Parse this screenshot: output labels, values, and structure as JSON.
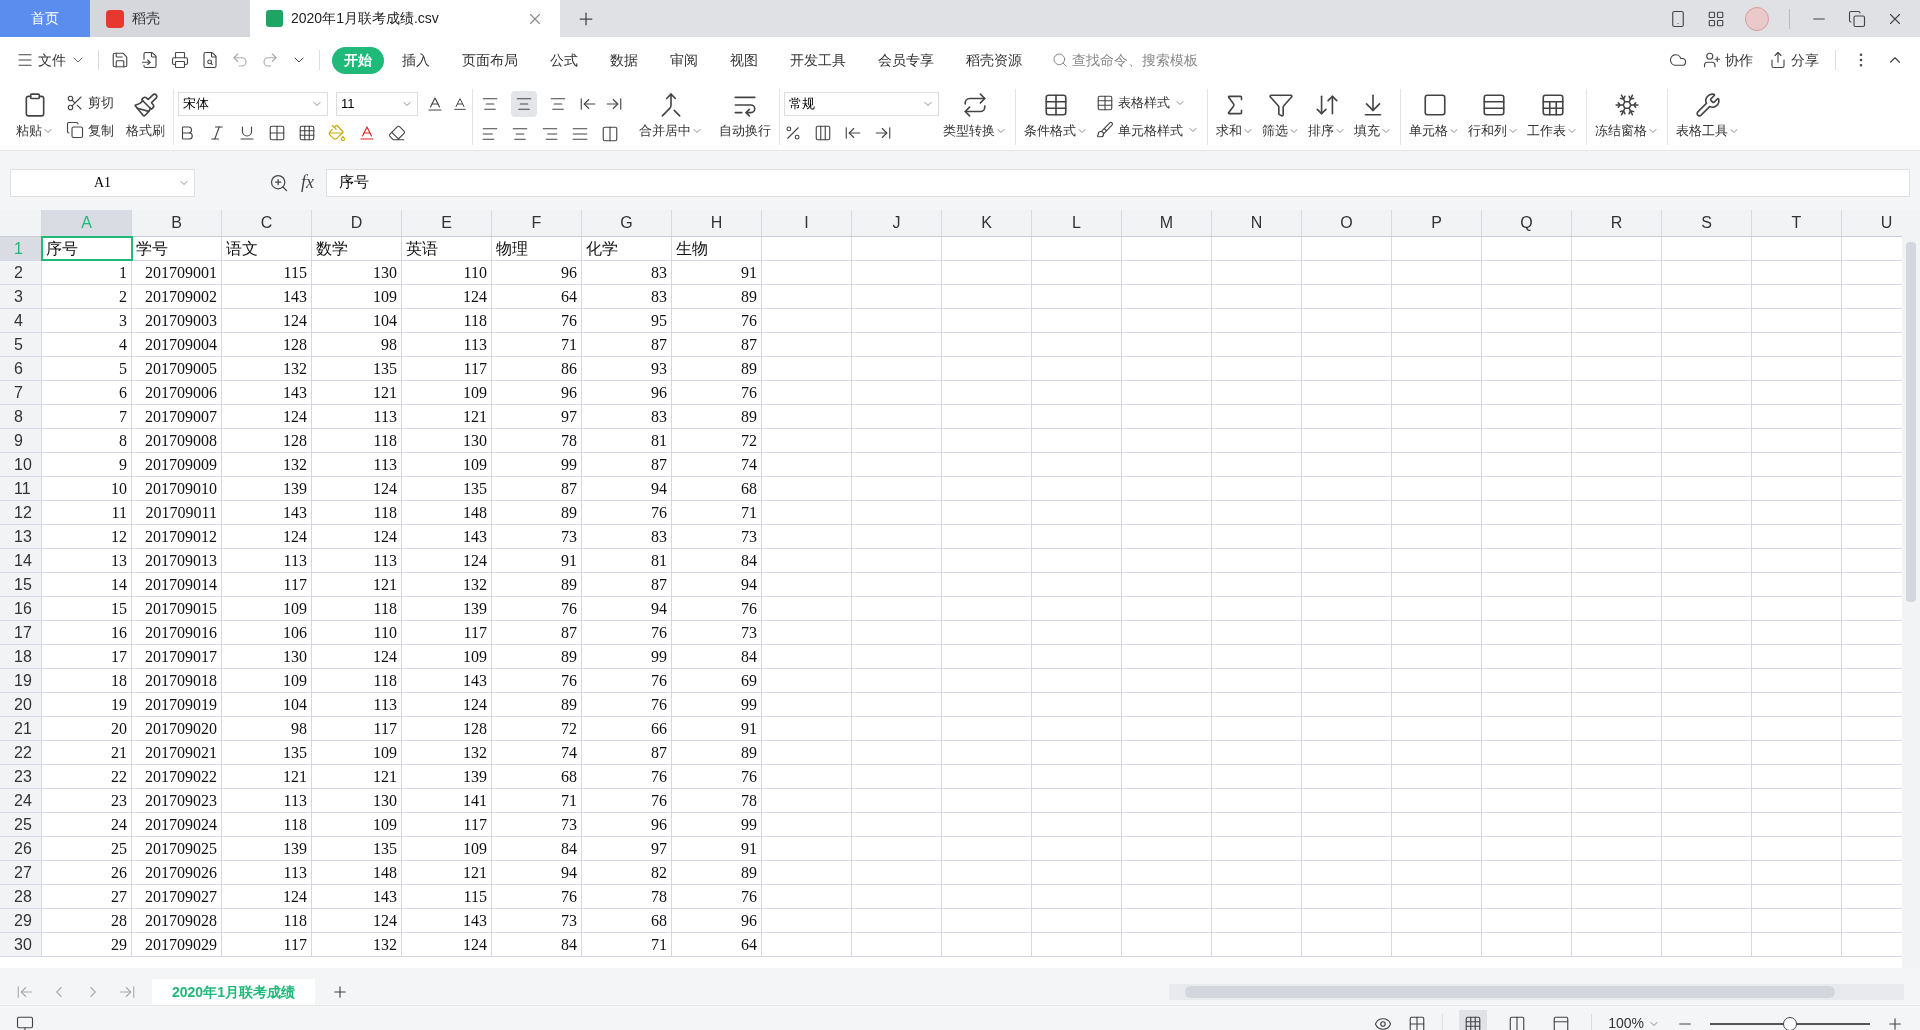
{
  "title_bar": {
    "tabs": [
      {
        "label": "首页",
        "kind": "home",
        "selected": false
      },
      {
        "label": "稻壳",
        "kind": "app",
        "selected": false
      },
      {
        "label": "2020年1月联考成绩.csv",
        "kind": "document",
        "selected": true
      }
    ]
  },
  "menu_bar": {
    "file": "文件",
    "tabs": [
      {
        "label": "开始",
        "selected": true
      },
      {
        "label": "插入",
        "selected": false
      },
      {
        "label": "页面布局",
        "selected": false
      },
      {
        "label": "公式",
        "selected": false
      },
      {
        "label": "数据",
        "selected": false
      },
      {
        "label": "审阅",
        "selected": false
      },
      {
        "label": "视图",
        "selected": false
      },
      {
        "label": "开发工具",
        "selected": false
      },
      {
        "label": "会员专享",
        "selected": false
      },
      {
        "label": "稻壳资源",
        "selected": false
      }
    ],
    "search": {
      "placeholder": "查找命令、搜索模板"
    },
    "collaborate": "协作",
    "share": "分享"
  },
  "ribbon": {
    "paste": "粘贴",
    "cut": "剪切",
    "copy": "复制",
    "format_painter": "格式刷",
    "font": "宋体",
    "font_size": "11",
    "vertical_align": [
      {
        "selected": false
      },
      {
        "selected": true
      },
      {
        "selected": false
      }
    ],
    "merge": "合并居中",
    "wrap": "自动换行",
    "number_format": "常规",
    "convert": "类型转换",
    "conditional_format": "条件格式",
    "table_style": "表格样式",
    "cell_style": "单元格样式",
    "tools": [
      {
        "label": "求和",
        "kind": "sum"
      },
      {
        "label": "筛选",
        "kind": "filter"
      },
      {
        "label": "排序",
        "kind": "sort"
      },
      {
        "label": "填充",
        "kind": "fill"
      },
      {
        "label": "单元格",
        "kind": "cell"
      },
      {
        "label": "行和列",
        "kind": "rowcol"
      },
      {
        "label": "工作表",
        "kind": "sheet"
      },
      {
        "label": "冻结窗格",
        "kind": "freeze"
      },
      {
        "label": "表格工具",
        "kind": "tools"
      }
    ]
  },
  "formula_bar": {
    "name_box": "A1",
    "fx": "fx",
    "formula": "序号"
  },
  "columns": [
    {
      "label": "A",
      "selected": true
    },
    {
      "label": "B",
      "selected": false
    },
    {
      "label": "C",
      "selected": false
    },
    {
      "label": "D",
      "selected": false
    },
    {
      "label": "E",
      "selected": false
    },
    {
      "label": "F",
      "selected": false
    },
    {
      "label": "G",
      "selected": false
    },
    {
      "label": "H",
      "selected": false
    },
    {
      "label": "I",
      "selected": false
    },
    {
      "label": "J",
      "selected": false
    },
    {
      "label": "K",
      "selected": false
    },
    {
      "label": "L",
      "selected": false
    },
    {
      "label": "M",
      "selected": false
    },
    {
      "label": "N",
      "selected": false
    },
    {
      "label": "O",
      "selected": false
    },
    {
      "label": "P",
      "selected": false
    },
    {
      "label": "Q",
      "selected": false
    },
    {
      "label": "R",
      "selected": false
    },
    {
      "label": "S",
      "selected": false
    },
    {
      "label": "T",
      "selected": false
    },
    {
      "label": "U",
      "selected": false
    }
  ],
  "rows": [
    {
      "number": "1",
      "kind": "header",
      "selected": true,
      "cells": [
        "序号",
        "学号",
        "语文",
        "数学",
        "英语",
        "物理",
        "化学",
        "生物"
      ]
    },
    {
      "number": "2",
      "kind": "data",
      "selected": false,
      "cells": [
        "1",
        "201709001",
        "115",
        "130",
        "110",
        "96",
        "83",
        "91"
      ]
    },
    {
      "number": "3",
      "kind": "data",
      "selected": false,
      "cells": [
        "2",
        "201709002",
        "143",
        "109",
        "124",
        "64",
        "83",
        "89"
      ]
    },
    {
      "number": "4",
      "kind": "data",
      "selected": false,
      "cells": [
        "3",
        "201709003",
        "124",
        "104",
        "118",
        "76",
        "95",
        "76"
      ]
    },
    {
      "number": "5",
      "kind": "data",
      "selected": false,
      "cells": [
        "4",
        "201709004",
        "128",
        "98",
        "113",
        "71",
        "87",
        "87"
      ]
    },
    {
      "number": "6",
      "kind": "data",
      "selected": false,
      "cells": [
        "5",
        "201709005",
        "132",
        "135",
        "117",
        "86",
        "93",
        "89"
      ]
    },
    {
      "number": "7",
      "kind": "data",
      "selected": false,
      "cells": [
        "6",
        "201709006",
        "143",
        "121",
        "109",
        "96",
        "96",
        "76"
      ]
    },
    {
      "number": "8",
      "kind": "data",
      "selected": false,
      "cells": [
        "7",
        "201709007",
        "124",
        "113",
        "121",
        "97",
        "83",
        "89"
      ]
    },
    {
      "number": "9",
      "kind": "data",
      "selected": false,
      "cells": [
        "8",
        "201709008",
        "128",
        "118",
        "130",
        "78",
        "81",
        "72"
      ]
    },
    {
      "number": "10",
      "kind": "data",
      "selected": false,
      "cells": [
        "9",
        "201709009",
        "132",
        "113",
        "109",
        "99",
        "87",
        "74"
      ]
    },
    {
      "number": "11",
      "kind": "data",
      "selected": false,
      "cells": [
        "10",
        "201709010",
        "139",
        "124",
        "135",
        "87",
        "94",
        "68"
      ]
    },
    {
      "number": "12",
      "kind": "data",
      "selected": false,
      "cells": [
        "11",
        "201709011",
        "143",
        "118",
        "148",
        "89",
        "76",
        "71"
      ]
    },
    {
      "number": "13",
      "kind": "data",
      "selected": false,
      "cells": [
        "12",
        "201709012",
        "124",
        "124",
        "143",
        "73",
        "83",
        "73"
      ]
    },
    {
      "number": "14",
      "kind": "data",
      "selected": false,
      "cells": [
        "13",
        "201709013",
        "113",
        "113",
        "124",
        "91",
        "81",
        "84"
      ]
    },
    {
      "number": "15",
      "kind": "data",
      "selected": false,
      "cells": [
        "14",
        "201709014",
        "117",
        "121",
        "132",
        "89",
        "87",
        "94"
      ]
    },
    {
      "number": "16",
      "kind": "data",
      "selected": false,
      "cells": [
        "15",
        "201709015",
        "109",
        "118",
        "139",
        "76",
        "94",
        "76"
      ]
    },
    {
      "number": "17",
      "kind": "data",
      "selected": false,
      "cells": [
        "16",
        "201709016",
        "106",
        "110",
        "117",
        "87",
        "76",
        "73"
      ]
    },
    {
      "number": "18",
      "kind": "data",
      "selected": false,
      "cells": [
        "17",
        "201709017",
        "130",
        "124",
        "109",
        "89",
        "99",
        "84"
      ]
    },
    {
      "number": "19",
      "kind": "data",
      "selected": false,
      "cells": [
        "18",
        "201709018",
        "109",
        "118",
        "143",
        "76",
        "76",
        "69"
      ]
    },
    {
      "number": "20",
      "kind": "data",
      "selected": false,
      "cells": [
        "19",
        "201709019",
        "104",
        "113",
        "124",
        "89",
        "76",
        "99"
      ]
    },
    {
      "number": "21",
      "kind": "data",
      "selected": false,
      "cells": [
        "20",
        "201709020",
        "98",
        "117",
        "128",
        "72",
        "66",
        "91"
      ]
    },
    {
      "number": "22",
      "kind": "data",
      "selected": false,
      "cells": [
        "21",
        "201709021",
        "135",
        "109",
        "132",
        "74",
        "87",
        "89"
      ]
    },
    {
      "number": "23",
      "kind": "data",
      "selected": false,
      "cells": [
        "22",
        "201709022",
        "121",
        "121",
        "139",
        "68",
        "76",
        "76"
      ]
    },
    {
      "number": "24",
      "kind": "data",
      "selected": false,
      "cells": [
        "23",
        "201709023",
        "113",
        "130",
        "141",
        "71",
        "76",
        "78"
      ]
    },
    {
      "number": "25",
      "kind": "data",
      "selected": false,
      "cells": [
        "24",
        "201709024",
        "118",
        "109",
        "117",
        "73",
        "96",
        "99"
      ]
    },
    {
      "number": "26",
      "kind": "data",
      "selected": false,
      "cells": [
        "25",
        "201709025",
        "139",
        "135",
        "109",
        "84",
        "97",
        "91"
      ]
    },
    {
      "number": "27",
      "kind": "data",
      "selected": false,
      "cells": [
        "26",
        "201709026",
        "113",
        "148",
        "121",
        "94",
        "82",
        "89"
      ]
    },
    {
      "number": "28",
      "kind": "data",
      "selected": false,
      "cells": [
        "27",
        "201709027",
        "124",
        "143",
        "115",
        "76",
        "78",
        "76"
      ]
    },
    {
      "number": "29",
      "kind": "data",
      "selected": false,
      "cells": [
        "28",
        "201709028",
        "118",
        "124",
        "143",
        "73",
        "68",
        "96"
      ]
    },
    {
      "number": "30",
      "kind": "data",
      "selected": false,
      "cells": [
        "29",
        "201709029",
        "117",
        "132",
        "124",
        "84",
        "71",
        "64"
      ]
    }
  ],
  "sheet_tabs": [
    {
      "label": "2020年1月联考成绩",
      "selected": true
    }
  ],
  "status_bar": {
    "view_modes": [
      {
        "kind": "normal",
        "selected": true
      },
      {
        "kind": "page",
        "selected": false
      },
      {
        "kind": "break",
        "selected": false
      }
    ],
    "zoom": "100%",
    "zoom_slider": {
      "level": 0.5
    }
  }
}
